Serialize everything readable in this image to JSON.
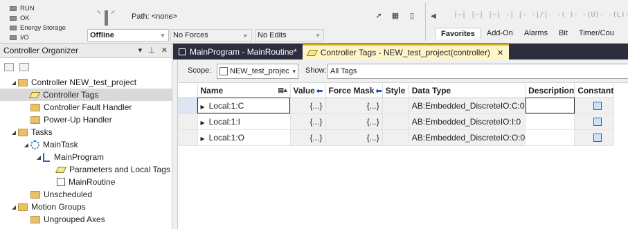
{
  "status": {
    "lights": [
      "RUN",
      "OK",
      "Energy Storage",
      "I/O"
    ],
    "mode": "Offline",
    "forces": "No Forces",
    "edits": "No Edits"
  },
  "path": {
    "label": "Path: <none>"
  },
  "instruction_tabs": [
    "Favorites",
    "Add-On",
    "Alarms",
    "Bit",
    "Timer/Cou"
  ],
  "ladder_icons": [
    "|—|",
    "|—|",
    "|—|",
    "-| |-",
    "-|/|-",
    "-( )-",
    "-(U)-",
    "-(L)-"
  ],
  "organizer": {
    "title": "Controller Organizer",
    "items": [
      {
        "label": "Controller NEW_test_project",
        "icon": "folder-icon",
        "level": 0,
        "expanded": true
      },
      {
        "label": "Controller Tags",
        "icon": "tag-icon",
        "level": 1,
        "selected": true
      },
      {
        "label": "Controller Fault Handler",
        "icon": "folder-icon",
        "level": 1
      },
      {
        "label": "Power-Up Handler",
        "icon": "folder-icon",
        "level": 1
      },
      {
        "label": "Tasks",
        "icon": "folder-icon",
        "level": 0,
        "expanded": true
      },
      {
        "label": "MainTask",
        "icon": "task-icon",
        "level": 1,
        "expanded": true
      },
      {
        "label": "MainProgram",
        "icon": "program-icon",
        "level": 2,
        "expanded": true
      },
      {
        "label": "Parameters and Local Tags",
        "icon": "tag-icon",
        "level": 3
      },
      {
        "label": "MainRoutine",
        "icon": "routine-icon",
        "level": 3
      },
      {
        "label": "Unscheduled",
        "icon": "folder-icon",
        "level": 1
      },
      {
        "label": "Motion Groups",
        "icon": "folder-icon",
        "level": 0,
        "expanded": true
      },
      {
        "label": "Ungrouped Axes",
        "icon": "folder-icon",
        "level": 1
      }
    ]
  },
  "doc_tabs": [
    {
      "label": "MainProgram - MainRoutine*",
      "active": false
    },
    {
      "label": "Controller Tags - NEW_test_project(controller)",
      "active": true
    }
  ],
  "scope": {
    "scope_label": "Scope:",
    "scope_value": "NEW_test_projec",
    "show_label": "Show:",
    "show_value": "All Tags"
  },
  "table": {
    "columns": [
      "Name",
      "Value",
      "Force Mask",
      "Style",
      "Data Type",
      "Description",
      "Constant"
    ],
    "rows": [
      {
        "name": "Local:1:C",
        "value": "{...}",
        "force_mask": "{...}",
        "style": "",
        "data_type": "AB:Embedded_DiscreteIO:C:0",
        "description": ""
      },
      {
        "name": "Local:1:I",
        "value": "{...}",
        "force_mask": "{...}",
        "style": "",
        "data_type": "AB:Embedded_DiscreteIO:I:0",
        "description": ""
      },
      {
        "name": "Local:1:O",
        "value": "{...}",
        "force_mask": "{...}",
        "style": "",
        "data_type": "AB:Embedded_DiscreteIO:O:0",
        "description": ""
      }
    ]
  }
}
